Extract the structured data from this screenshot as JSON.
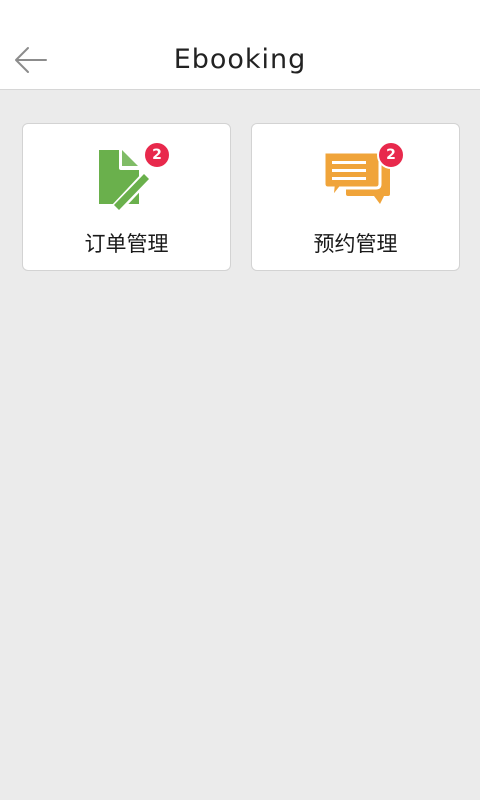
{
  "header": {
    "title": "Ebooking",
    "back_icon": "arrow-left-icon"
  },
  "cards": [
    {
      "label": "订单管理",
      "badge": "2",
      "icon": "document-edit-icon",
      "icon_color": "#6ab04c"
    },
    {
      "label": "预约管理",
      "badge": "2",
      "icon": "chat-bubbles-icon",
      "icon_color": "#f0a43a"
    }
  ],
  "colors": {
    "background": "#ebebeb",
    "header": "#ffffff",
    "badge": "#e8294c"
  }
}
